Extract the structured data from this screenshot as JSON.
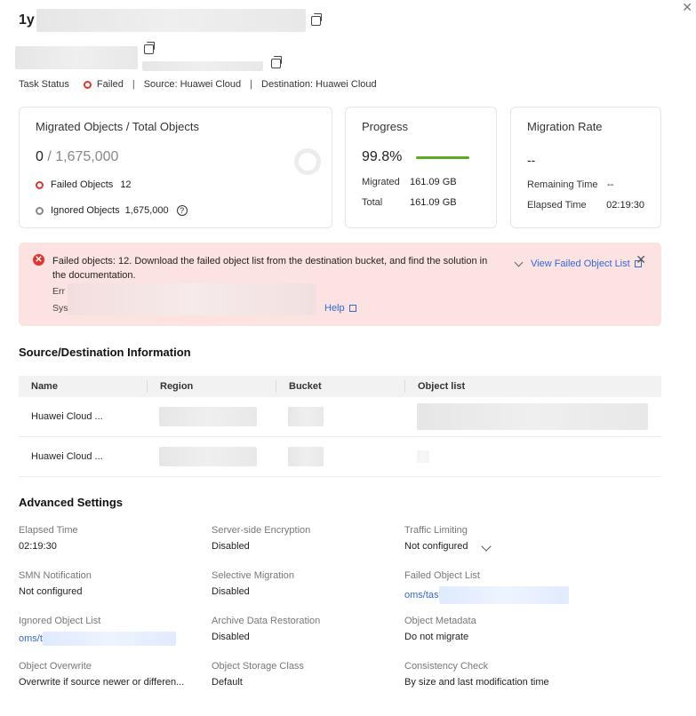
{
  "header": {
    "title_prefix": "1y",
    "close_label": "✕"
  },
  "status": {
    "task_status_label": "Task Status",
    "task_status_value": "Failed",
    "source": "Source: Huawei Cloud",
    "destination": "Destination: Huawei Cloud",
    "separator": "|",
    "fail_color": "#e0342f"
  },
  "cards": {
    "migrated": {
      "title": "Migrated Objects / Total Objects",
      "migrated": "0",
      "slash": " / ",
      "total": "1,675,000",
      "failed_label": "Failed Objects",
      "failed_value": "12",
      "ignored_label": "Ignored Objects",
      "ignored_value": "1,675,000"
    },
    "progress": {
      "title": "Progress",
      "percent": "99.8%",
      "progress_fraction": 0.998,
      "migrated_label": "Migrated",
      "migrated_value": "161.09 GB",
      "total_label": "Total",
      "total_value": "161.09 GB",
      "bar_color": "#5aab20"
    },
    "rate": {
      "title": "Migration Rate",
      "rate_value": "--",
      "remaining_label": "Remaining Time",
      "remaining_value": "--",
      "elapsed_label": "Elapsed Time",
      "elapsed_value": "02:19:30"
    }
  },
  "alert": {
    "message": "Failed objects: 12. Download the failed object list from the destination bucket, and find the solution in the documentation.",
    "view_link": "View Failed Object List",
    "error_prefix": "Err",
    "system_prefix": "Sys",
    "help_link": "Help",
    "close_label": "✕",
    "bg_color": "#fde2e2"
  },
  "source_dest": {
    "title": "Source/Destination Information",
    "columns": [
      "Name",
      "Region",
      "Bucket",
      "Object list"
    ],
    "rows": [
      {
        "name": "Huawei Cloud ..."
      },
      {
        "name": "Huawei Cloud ..."
      }
    ]
  },
  "advanced": {
    "title": "Advanced Settings",
    "items": [
      {
        "label": "Elapsed Time",
        "value": "02:19:30"
      },
      {
        "label": "Server-side Encryption",
        "value": "Disabled"
      },
      {
        "label": "Traffic Limiting",
        "value": "Not configured"
      },
      {
        "label": "SMN Notification",
        "value": "Not configured"
      },
      {
        "label": "Selective Migration",
        "value": "Disabled"
      },
      {
        "label": "Failed Object List",
        "value": "oms/tas"
      },
      {
        "label": "Ignored Object List",
        "value": "oms/t"
      },
      {
        "label": "Archive Data Restoration",
        "value": "Disabled"
      },
      {
        "label": "Object Metadata",
        "value": "Do not migrate"
      },
      {
        "label": "Object Overwrite",
        "value": "Overwrite if source newer or differen..."
      },
      {
        "label": "Object Storage Class",
        "value": "Default"
      },
      {
        "label": "Consistency Check",
        "value": "By size and last modification time"
      }
    ]
  }
}
